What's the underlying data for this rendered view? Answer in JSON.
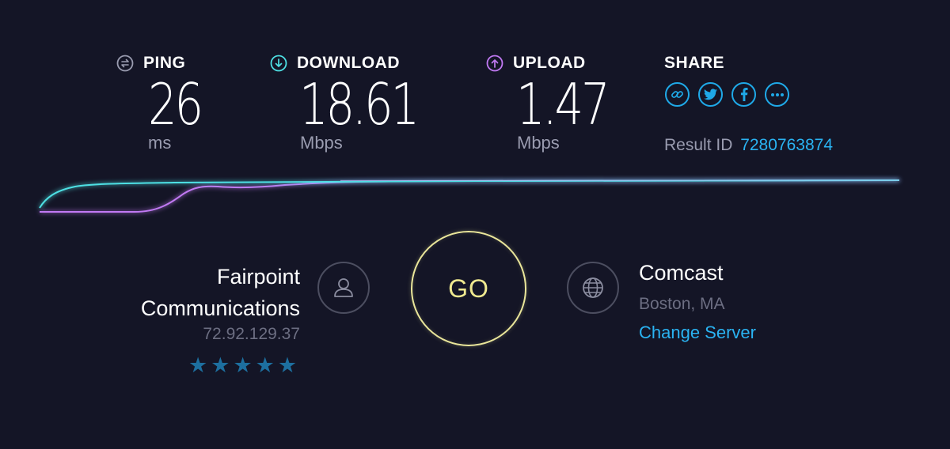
{
  "metrics": {
    "ping": {
      "label": "PING",
      "value": "26",
      "unit": "ms",
      "icon": "ping-icon"
    },
    "download": {
      "label": "DOWNLOAD",
      "value": "18.61",
      "unit": "Mbps",
      "icon": "download-icon",
      "color": "#4ee0e4"
    },
    "upload": {
      "label": "UPLOAD",
      "value": "1.47",
      "unit": "Mbps",
      "icon": "upload-icon",
      "color": "#c179f3"
    }
  },
  "share": {
    "label": "SHARE",
    "icons": [
      "link-icon",
      "twitter-icon",
      "facebook-icon",
      "more-icon"
    ],
    "result_label": "Result ID",
    "result_id": "7280763874"
  },
  "isp": {
    "name_line1": "Fairpoint",
    "name_line2": "Communications",
    "ip": "72.92.129.37",
    "rating_stars": 5
  },
  "go": {
    "label": "GO"
  },
  "server": {
    "name": "Comcast",
    "location": "Boston, MA",
    "change_label": "Change Server"
  },
  "colors": {
    "background": "#141526",
    "accent_blue": "#2ab3f2",
    "go_yellow": "#efe98f",
    "download_line": "#4ee0e4",
    "upload_line": "#c179f3"
  }
}
